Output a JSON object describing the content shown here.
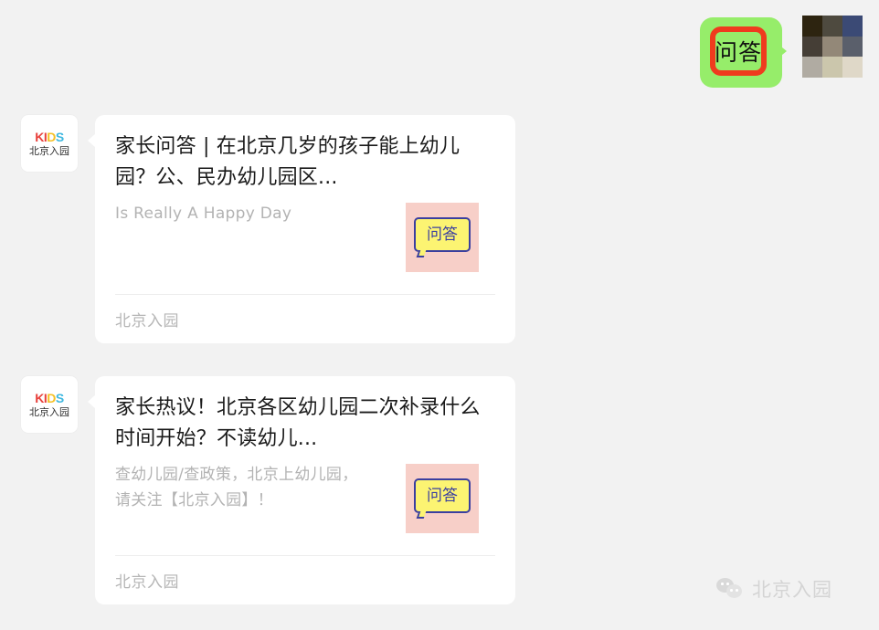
{
  "background_color": "#f2f2f2",
  "sticker": {
    "label": "问答",
    "bubble_color": "#96ed6a",
    "frame_color": "#ef3b1e",
    "text_color": "#111111"
  },
  "mosaic": {
    "name": "pixelated-image",
    "colors": [
      "#2d2410",
      "#4e4a3f",
      "#3b4a75",
      "#453e36",
      "#938878",
      "#5a5f6b",
      "#b0aba2",
      "#cbc6ac",
      "#dfd8c8"
    ]
  },
  "avatar": {
    "brand": "KIDS",
    "brand_letters": [
      {
        "char": "K",
        "color": "#e8413c"
      },
      {
        "char": "I",
        "color": "#e8413c"
      },
      {
        "char": "D",
        "color": "#f5c026"
      },
      {
        "char": "S",
        "color": "#3fb8e0"
      }
    ],
    "name": "北京入园"
  },
  "messages": [
    {
      "title": "家长问答 | 在北京几岁的孩子能上幼儿园？公、民办幼儿园区...",
      "description": "Is Really A Happy Day",
      "thumbnail": {
        "label": "问答",
        "background": "#f7cfc8",
        "bubble_fill": "#fcf472",
        "bubble_stroke": "#3a3fa0"
      },
      "footer": "北京入园"
    },
    {
      "title": "家长热议！北京各区幼儿园二次补录什么时间开始？不读幼儿...",
      "description": "查幼儿园/查政策，北京上幼儿园，请关注【北京入园】！",
      "thumbnail": {
        "label": "问答",
        "background": "#f7cfc8",
        "bubble_fill": "#fcf472",
        "bubble_stroke": "#3a3fa0"
      },
      "footer": "北京入园"
    }
  ],
  "watermark": {
    "account_name": "北京入园",
    "icon": "wechat-icon"
  }
}
